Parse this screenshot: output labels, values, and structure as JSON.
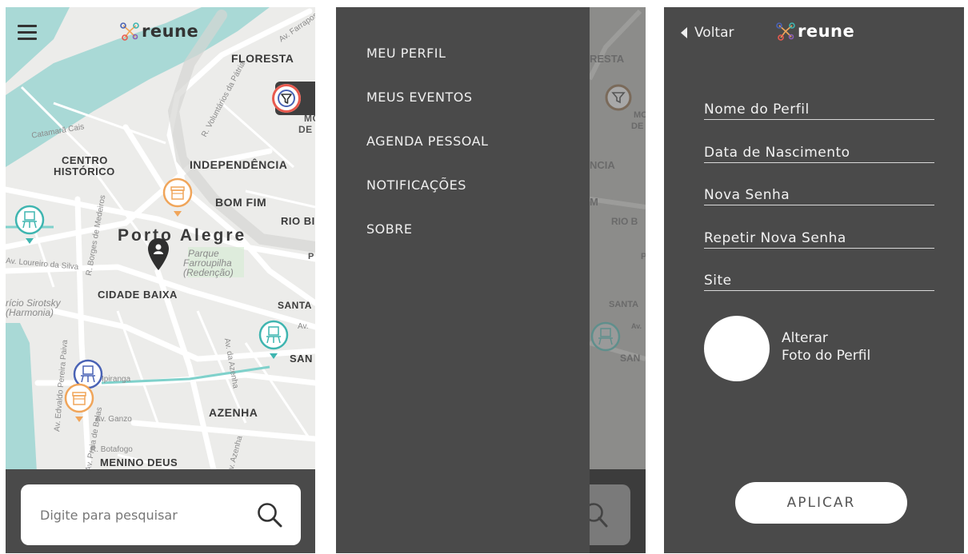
{
  "brand": {
    "name": "reune",
    "colors": {
      "dark_panel": "#4a4a4a",
      "map_land": "#ececea",
      "map_water": "#a9d9d6",
      "accent_teal": "#3fb5b0",
      "accent_orange": "#f0a55a",
      "accent_blue": "#4a63b5"
    }
  },
  "map_screen": {
    "city_label": "Porto Alegre",
    "neighborhoods": [
      "FLORESTA",
      "CENTRO",
      "HISTÓRICO",
      "INDEPENDÊNCIA",
      "BOM FIM",
      "RIO BI",
      "CIDADE BAIXA",
      "SANTA",
      "SAN",
      "AZENHA",
      "MENINO DEUS",
      "MO",
      "DE",
      "P"
    ],
    "streets": [
      "Av. Farrapos",
      "R. Voluntários da Pátria",
      "Catamarã Cais",
      "Av. Loureiro da Silva",
      "R. Borges de Medeiros",
      "Av. Edvaldo Pereira Paiva",
      "Av. Praia de Belas",
      "Av. da Azenha",
      "Av. Ganzo",
      "R. Botafogo",
      "Av. Azenha",
      "Av.",
      "Ipiranga"
    ],
    "park": [
      "Parque",
      "Farroupilha",
      "(Redenção)"
    ],
    "place": [
      "rício Sirotsky",
      "(Harmonia)"
    ],
    "search": {
      "placeholder": "Digite para pesquisar"
    },
    "icons": {
      "menu": "hamburger-icon",
      "filter": "filter-icon",
      "search": "search-icon"
    }
  },
  "menu_screen": {
    "items": [
      {
        "label": "MEU PERFIL"
      },
      {
        "label": "MEUS EVENTOS"
      },
      {
        "label": "AGENDA PESSOAL"
      },
      {
        "label": "NOTIFICAÇÕES"
      },
      {
        "label": "SOBRE"
      }
    ],
    "ghost_labels": [
      "RESTA",
      "MO",
      "DE",
      "NCIA",
      "M",
      "RIO B",
      "P",
      "SANTA",
      "SAN",
      "Av."
    ]
  },
  "profile_screen": {
    "back_label": "Voltar",
    "fields": [
      {
        "label": "Nome do Perfil"
      },
      {
        "label": "Data de Nascimento"
      },
      {
        "label": "Nova Senha"
      },
      {
        "label": "Repetir Nova Senha"
      },
      {
        "label": "Site"
      }
    ],
    "photo_label_line1": "Alterar",
    "photo_label_line2": "Foto do Perfil",
    "apply_label": "APLICAR"
  }
}
